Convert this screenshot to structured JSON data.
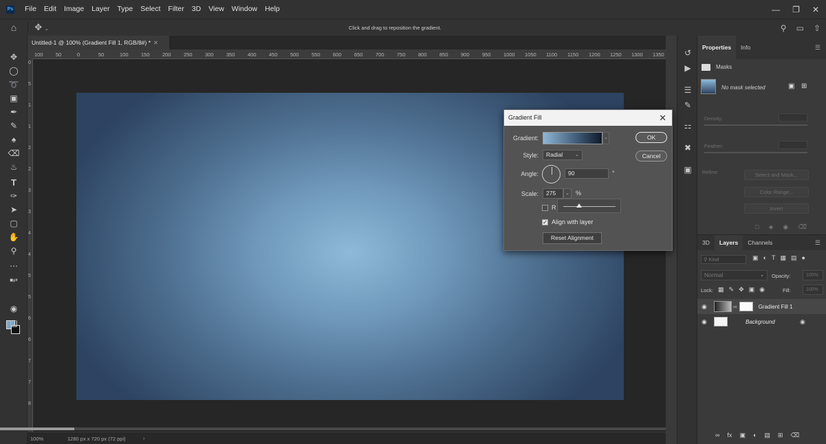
{
  "app": {
    "logo": "Ps",
    "menus": [
      "File",
      "Edit",
      "Image",
      "Layer",
      "Type",
      "Select",
      "Filter",
      "3D",
      "View",
      "Window",
      "Help"
    ]
  },
  "options_bar": {
    "hint": "Click and drag to reposition the gradient."
  },
  "document": {
    "tab_title": "Untitled-1 @ 100% (Gradient Fill 1, RGB/8#) *",
    "status_zoom": "100%",
    "status_info": "1280 px x 720 px (72 ppi)"
  },
  "rulers": {
    "h_ticks": [
      "100",
      "50",
      "0",
      "50",
      "100",
      "150",
      "200",
      "250",
      "300",
      "350",
      "400",
      "450",
      "500",
      "550",
      "600",
      "650",
      "700",
      "750",
      "800",
      "850",
      "900",
      "950",
      "1000",
      "1050",
      "1100",
      "1150",
      "1200",
      "1250",
      "1300",
      "1350"
    ],
    "v_ticks": [
      "0",
      "5",
      "1",
      "1",
      "2",
      "2",
      "3",
      "3",
      "4",
      "4",
      "5",
      "5",
      "6",
      "6",
      "7",
      "7",
      "8"
    ]
  },
  "dialog": {
    "title": "Gradient Fill",
    "gradient_label": "Gradient:",
    "style_label": "Style:",
    "style_value": "Radial",
    "angle_label": "Angle:",
    "angle_value": "90",
    "angle_unit": "°",
    "scale_label": "Scale:",
    "scale_value": "275",
    "scale_unit": "%",
    "reverse_label": "R",
    "align_label": "Align with layer",
    "reset_button": "Reset Alignment",
    "ok_button": "OK",
    "cancel_button": "Cancel",
    "reverse_checked": false,
    "align_checked": true
  },
  "properties": {
    "tabs": [
      "Properties",
      "Info"
    ],
    "section": "Masks",
    "no_mask": "No mask selected",
    "density_label": "Density:",
    "feather_label": "Feather:",
    "refine_label": "Refine:",
    "select_and_mask": "Select and Mask...",
    "color_range": "Color Range...",
    "invert": "Invert"
  },
  "layers_panel": {
    "tabs": [
      "3D",
      "Layers",
      "Channels"
    ],
    "search_placeholder": "Kind",
    "blend_mode": "Normal",
    "opacity_label": "Opacity:",
    "opacity_value": "100%",
    "lock_label": "Lock:",
    "fill_label": "Fill:",
    "fill_value": "100%",
    "layers": [
      {
        "name": "Gradient Fill 1",
        "selected": true
      },
      {
        "name": "Background",
        "selected": false
      }
    ]
  }
}
